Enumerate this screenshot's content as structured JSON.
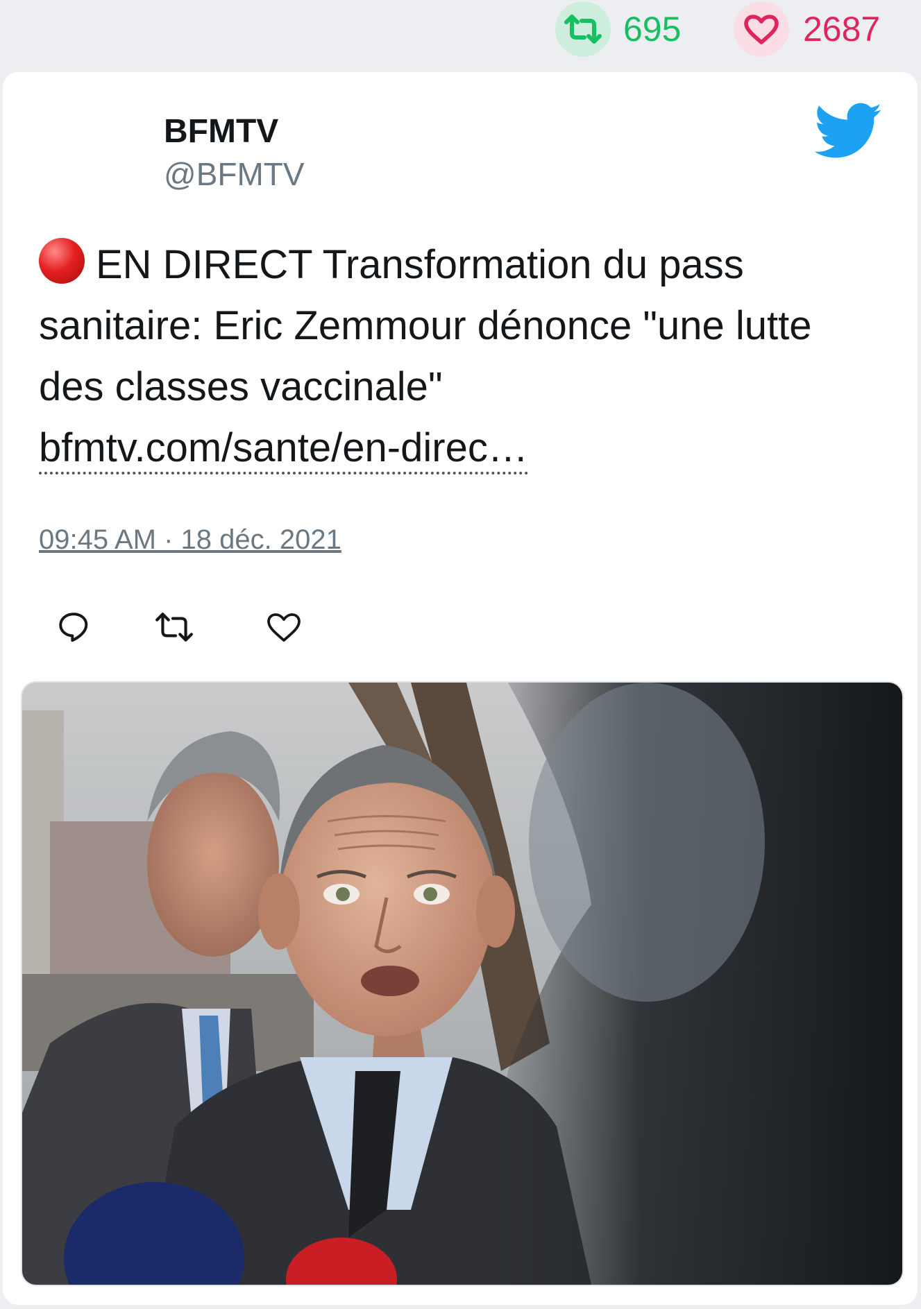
{
  "header_stats": {
    "retweets": "695",
    "likes": "2687",
    "retweet_color": "#17bf63",
    "like_color": "#e0245e"
  },
  "tweet": {
    "author_name": "BFMTV",
    "author_handle": "@BFMTV",
    "emoji": "red-circle",
    "text": "EN DIRECT Transformation du pass sanitaire: Eric Zemmour dénonce \"une lutte des classes vaccinale\"",
    "link": "bfmtv.com/sante/en-direc…",
    "timestamp": "09:45 AM · 18 déc. 2021"
  },
  "icons": {
    "brand": "twitter-bird-icon",
    "reply": "reply-icon",
    "retweet": "retweet-icon",
    "like": "heart-icon"
  }
}
